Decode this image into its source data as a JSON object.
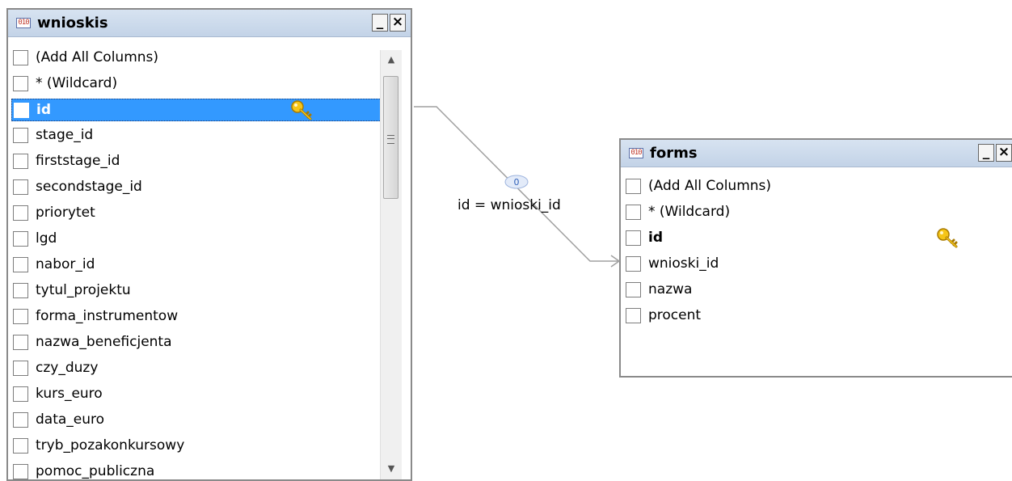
{
  "tables": {
    "wnioskis": {
      "title": "wnioskis",
      "minimize": "_",
      "close": "×",
      "columns": [
        "(Add All Columns)",
        "* (Wildcard)",
        "id",
        "stage_id",
        "firststage_id",
        "secondstage_id",
        "priorytet",
        "lgd",
        "nabor_id",
        "tytul_projektu",
        "forma_instrumentow",
        "nazwa_beneficjenta",
        "czy_duzy",
        "kurs_euro",
        "data_euro",
        "tryb_pozakonkursowy",
        "pomoc_publiczna"
      ],
      "selected_column": "id",
      "primary_key": "id"
    },
    "forms": {
      "title": "forms",
      "minimize": "_",
      "close": "×",
      "columns": [
        "(Add All Columns)",
        "* (Wildcard)",
        "id",
        "wnioski_id",
        "nazwa",
        "procent"
      ],
      "primary_key": "id"
    }
  },
  "join": {
    "label": "id = wnioski_id",
    "badge": "0"
  },
  "colors": {
    "titlebar": "#c3d3e7",
    "selection": "#3399ff",
    "join_line": "#a0a0a0",
    "key_gold": "#f5c518"
  },
  "icons": {
    "table": "table-icon",
    "key": "key-icon",
    "join_badge": "join-type-icon"
  }
}
